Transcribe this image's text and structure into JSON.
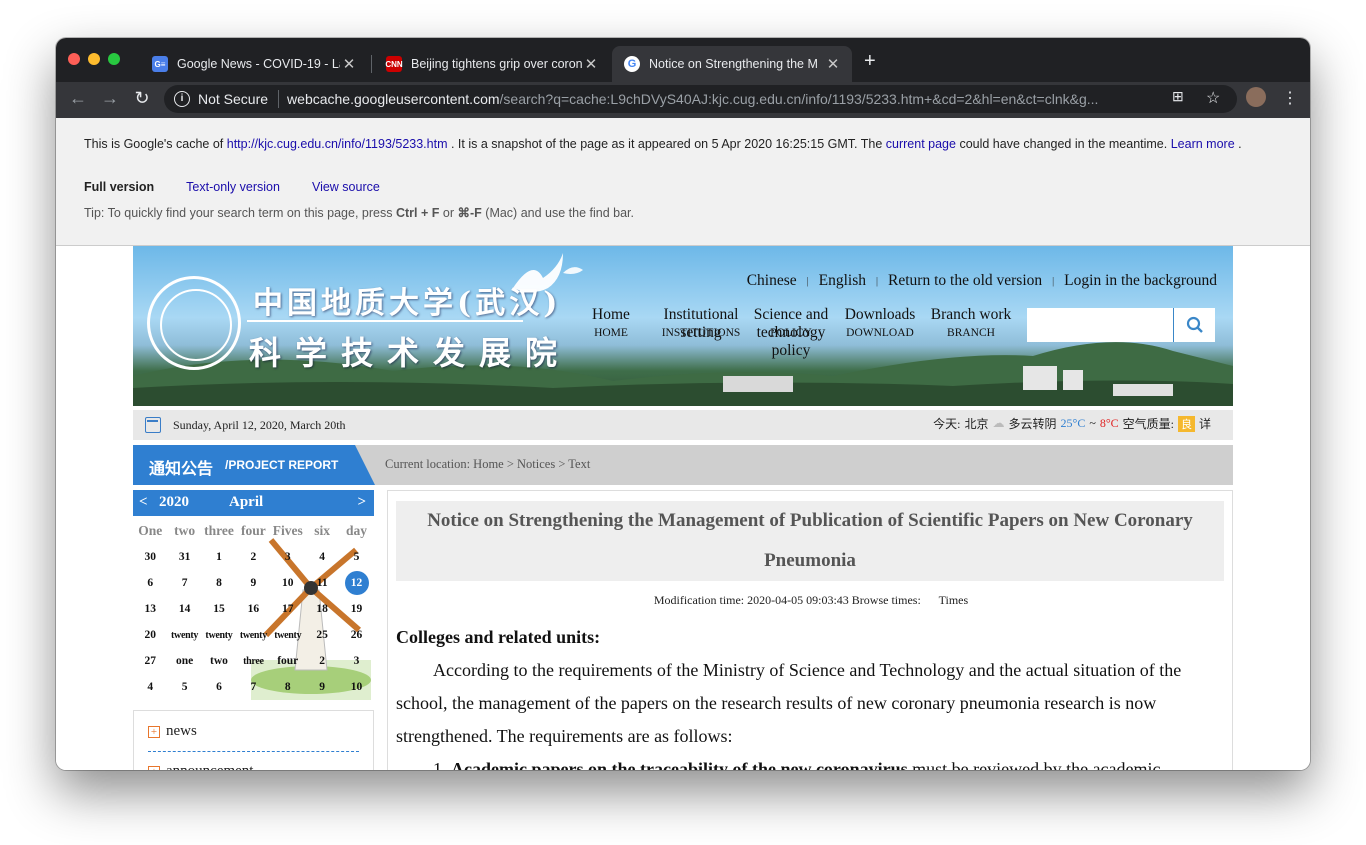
{
  "browser": {
    "tabs": [
      {
        "title": "Google News - COVID-19 - Lat",
        "favicon": "google-news-icon"
      },
      {
        "title": "Beijing tightens grip over coron",
        "favicon": "cnn-icon"
      },
      {
        "title": "Notice on Strengthening the M",
        "favicon": "google-icon",
        "active": true
      }
    ],
    "security_label": "Not Secure",
    "url_host": "webcache.googleusercontent.com",
    "url_rest": "/search?q=cache:L9chDVyS40AJ:kjc.cug.edu.cn/info/1193/5233.htm+&cd=2&hl=en&ct=clnk&g..."
  },
  "cache": {
    "intro": "This is Google's cache of",
    "cached_url": "http://kjc.cug.edu.cn/info/1193/5233.htm",
    "snapshot_text": ".  It is a snapshot of the page as it appeared on 5 Apr 2020 16:25:15 GMT.  The",
    "current_page": "current page",
    "changed_text": "could have changed in the meantime.",
    "learn_more": "Learn more",
    "learn_more_tail": ".",
    "full_version": "Full version",
    "text_only": "Text-only version",
    "view_source": "View source",
    "tip_pre": "Tip: To quickly find your search term on this page, press",
    "tip_keys1": "Ctrl + F",
    "tip_or": "or",
    "tip_keys2": "⌘-F",
    "tip_post": "(Mac) and use the find bar."
  },
  "site": {
    "cn_title_1": "中国地质大学(武汉)",
    "cn_title_2": "科学技术发展院",
    "top_links": [
      "Chinese",
      "English",
      "Return to the old version",
      "Login in the background"
    ],
    "nav": [
      {
        "en": "Home",
        "sub": "HOME"
      },
      {
        "en": "Institutional",
        "en2": "setting",
        "sub": "INSTITUTIONS"
      },
      {
        "en": "Science and",
        "en2": "technology",
        "en3": "policy",
        "sub": "POLICY"
      },
      {
        "en": "Downloads",
        "sub": "DOWNLOAD"
      },
      {
        "en": "Branch work",
        "sub": "BRANCH"
      }
    ],
    "date_text": "Sunday, April 12, 2020, March 20th",
    "weather": {
      "today": "今天:",
      "city": "北京",
      "cond": "多云转阴",
      "high": "25°C",
      "tilde": "~",
      "low": "8°C",
      "aq_label": "空气质量:",
      "aq_value": "良",
      "detail": "详"
    },
    "section_cn": "通知公告",
    "section_en": "/PROJECT REPORT",
    "breadcrumb": "Current location: Home > Notices > Text",
    "calendar": {
      "year": "2020",
      "month": "April",
      "prev": "<",
      "next": ">",
      "headers": [
        "One",
        "two",
        "three",
        "four",
        "Fives",
        "six",
        "day"
      ],
      "rows": [
        [
          "30",
          "31",
          "1",
          "2",
          "3",
          "4",
          "5"
        ],
        [
          "6",
          "7",
          "8",
          "9",
          "10",
          "11",
          "12"
        ],
        [
          "13",
          "14",
          "15",
          "16",
          "17",
          "18",
          "19"
        ],
        [
          "20",
          "twenty",
          "twenty",
          "twenty",
          "twenty",
          "25",
          "26"
        ],
        [
          "27",
          "one",
          "two",
          "three",
          "four",
          "2",
          "3"
        ],
        [
          "4",
          "5",
          "6",
          "7",
          "8",
          "9",
          "10"
        ]
      ],
      "today": "12"
    },
    "side_items": [
      "news",
      "announcement"
    ],
    "article": {
      "title": "Notice on Strengthening the Management of Publication of Scientific Papers on New Coronary Pneumonia",
      "meta": "Modification time: 2020-04-05 09:03:43 Browse times:      Times",
      "greeting": "Colleges and related units:",
      "para1": "According to the requirements of the Ministry of Science and Technology and the actual situation of the school, the management of the papers on the research results of new coronary pneumonia research is now strengthened. The requirements are as follows:",
      "item1_num": "1.",
      "item1_bold": "Academic papers on the traceability of the new coronavirus",
      "item1_rest": " must be reviewed by the academic"
    }
  },
  "colors": {
    "accent_blue": "#2f7fd1",
    "chrome_dark": "#202124",
    "link": "#1a0dab",
    "temp_high": "#2f7fd1",
    "temp_low": "#e02020",
    "aq": "#f5b82e"
  }
}
